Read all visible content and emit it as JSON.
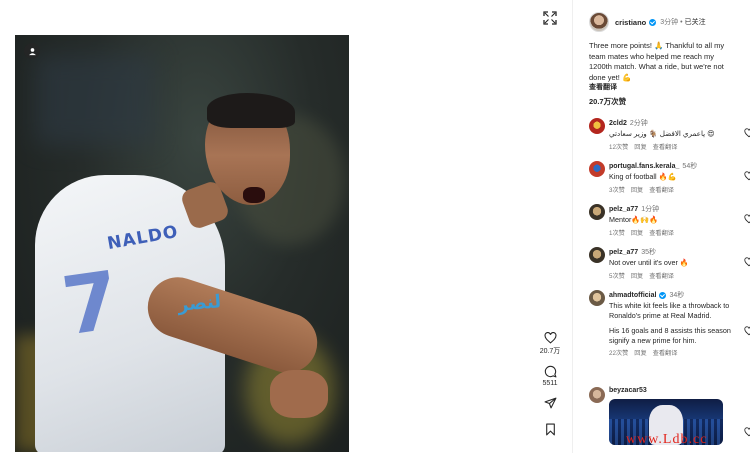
{
  "post": {
    "like_count": "20.7万",
    "comment_count": "5511"
  },
  "header": {
    "username": "cristiano",
    "time": "3分钟",
    "separator": "•",
    "follow_label": "已关注"
  },
  "caption": {
    "text": "Three more points! 🙏 Thankful to all my team mates who helped me reach my 1200th match. What a ride, but we're not done yet! 💪",
    "see_translation": "查看翻译",
    "likes": "20.7万次赞"
  },
  "comments": [
    {
      "user": "2cld2",
      "time": "2分钟",
      "text": "ياعمري الافضل 🐐 وزير سعادتي 😍",
      "likes": "12次赞",
      "reply": "回复",
      "translate": "查看翻译"
    },
    {
      "user": "portugal.fans.kerala_",
      "time": "54秒",
      "text": "King of football 🔥💪",
      "likes": "3次赞",
      "reply": "回复",
      "translate": "查看翻译"
    },
    {
      "user": "pelz_a77",
      "time": "1分钟",
      "text": "Mentor🔥🙌🔥",
      "likes": "1次赞",
      "reply": "回复",
      "translate": "查看翻译"
    },
    {
      "user": "pelz_a77",
      "time": "35秒",
      "text": "Not over until it's over 🔥",
      "likes": "5次赞",
      "reply": "回复",
      "translate": "查看翻译"
    },
    {
      "user": "ahmadtofficial",
      "time": "34秒",
      "text": "This white kit feels like a throwback to Ronaldo's prime at Real Madrid.",
      "text2": "His 16 goals and 8 assists this season signify a new prime for him.",
      "likes": "22次赞",
      "reply": "回复",
      "translate": "查看翻译"
    },
    {
      "user": "beyzacar53"
    }
  ],
  "photo": {
    "shirt_name": "NALDO",
    "shirt_number": "7",
    "shirt_logo": "ﻟﻨﺼﺮ"
  },
  "watermark": "www.Ldb.cc",
  "colors": {
    "verified": "#0095f6",
    "watermark": "#e2231a"
  }
}
